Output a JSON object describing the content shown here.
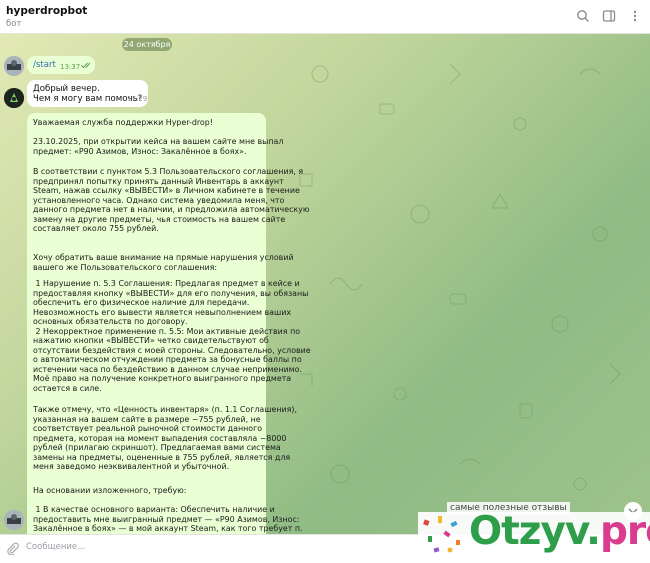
{
  "header": {
    "title": "hyperdropbot",
    "subtitle": "бот"
  },
  "chat": {
    "date_separator": "24 октября",
    "out_message": {
      "text": "/start",
      "time": "13:37"
    },
    "in_message": {
      "line1": "Добрый вечер.",
      "line2": "Чем я могу вам помочь?",
      "time": "17:29"
    },
    "long_message": {
      "p1": "Уважаемая служба поддержки Hyper-drop!",
      "p2": "23.10.2025, при открытии кейса на вашем сайте мне выпал\nпредмет: «P90 Азимов, Износ: Закалённое в боях».",
      "p3": "В соответствии с пунктом 5.3 Пользовательского соглашения, я\nпредпринял попытку принять данный Инвентарь в аккаунт\nSteam, нажав ссылку «ВЫВЕСТИ» в Личном кабинете в течение\nустановленного часа. Однако система уведомила меня, что\nданного предмета нет в наличии, и предложила автоматическую\nзамену на другие предметы, чья стоимость на вашем сайте\nсоставляет около 755 рублей.",
      "p4": "Хочу обратить ваше внимание на прямые нарушения условий\nвашего же Пользовательского соглашения:",
      "p5": " 1 Нарушение п. 5.3 Соглашения: Предлагая предмет в кейсе и\nпредоставляя кнопку «ВЫВЕСТИ» для его получения, вы обязаны\nобеспечить его физическое наличие для передачи.\nНевозможность его вывести является невыполнением ваших\nосновных обязательств по договору.\n 2 Некорректное применение п. 5.5: Мои активные действия по\nнажатию кнопки «ВЫВЕСТИ» четко свидетельствуют об\nотсутствии бездействия с моей стороны. Следовательно, условие\nо автоматическом отчуждении предмета за бонусные баллы по\nистечении часа по бездействию в данном случае неприменимо.\nМоё право на получение конкретного выигранного предмета\nостается в силе.",
      "p6": "Также отмечу, что «Ценность инвентаря» (п. 1.1 Соглашения),\nуказанная на вашем сайте в размере ~755 рублей, не\nсоответствует реальной рыночной стоимости данного\nпредмета, которая на момент выпадения составляла ~8000\nрублей (прилагаю скриншот). Предлагаемая вами система\nзамены на предметы, оцененные в 755 рублей, является для\nменя заведомо неэквивалентной и убыточной.",
      "p7": "На основании изложенного, требую:",
      "p8": " 1 В качестве основного варианта: Обеспечить наличие и\nпредоставить мне выигранный предмет — «P90 Азимов, Износ:\nЗакалённое в боях» — в мой аккаунт Steam, как того требует п."
    }
  },
  "composer": {
    "placeholder": "Сообщение..."
  },
  "watermark": {
    "caption": "самые полезные отзывы",
    "brand_main": "Otzyv.",
    "brand_accent": "pro"
  },
  "colors": {
    "out_bubble": "#eaffd3",
    "in_bubble": "#ffffff",
    "link": "#2f6fb0",
    "brand_green": "#2f9e4a",
    "brand_pink": "#d93b8e"
  }
}
